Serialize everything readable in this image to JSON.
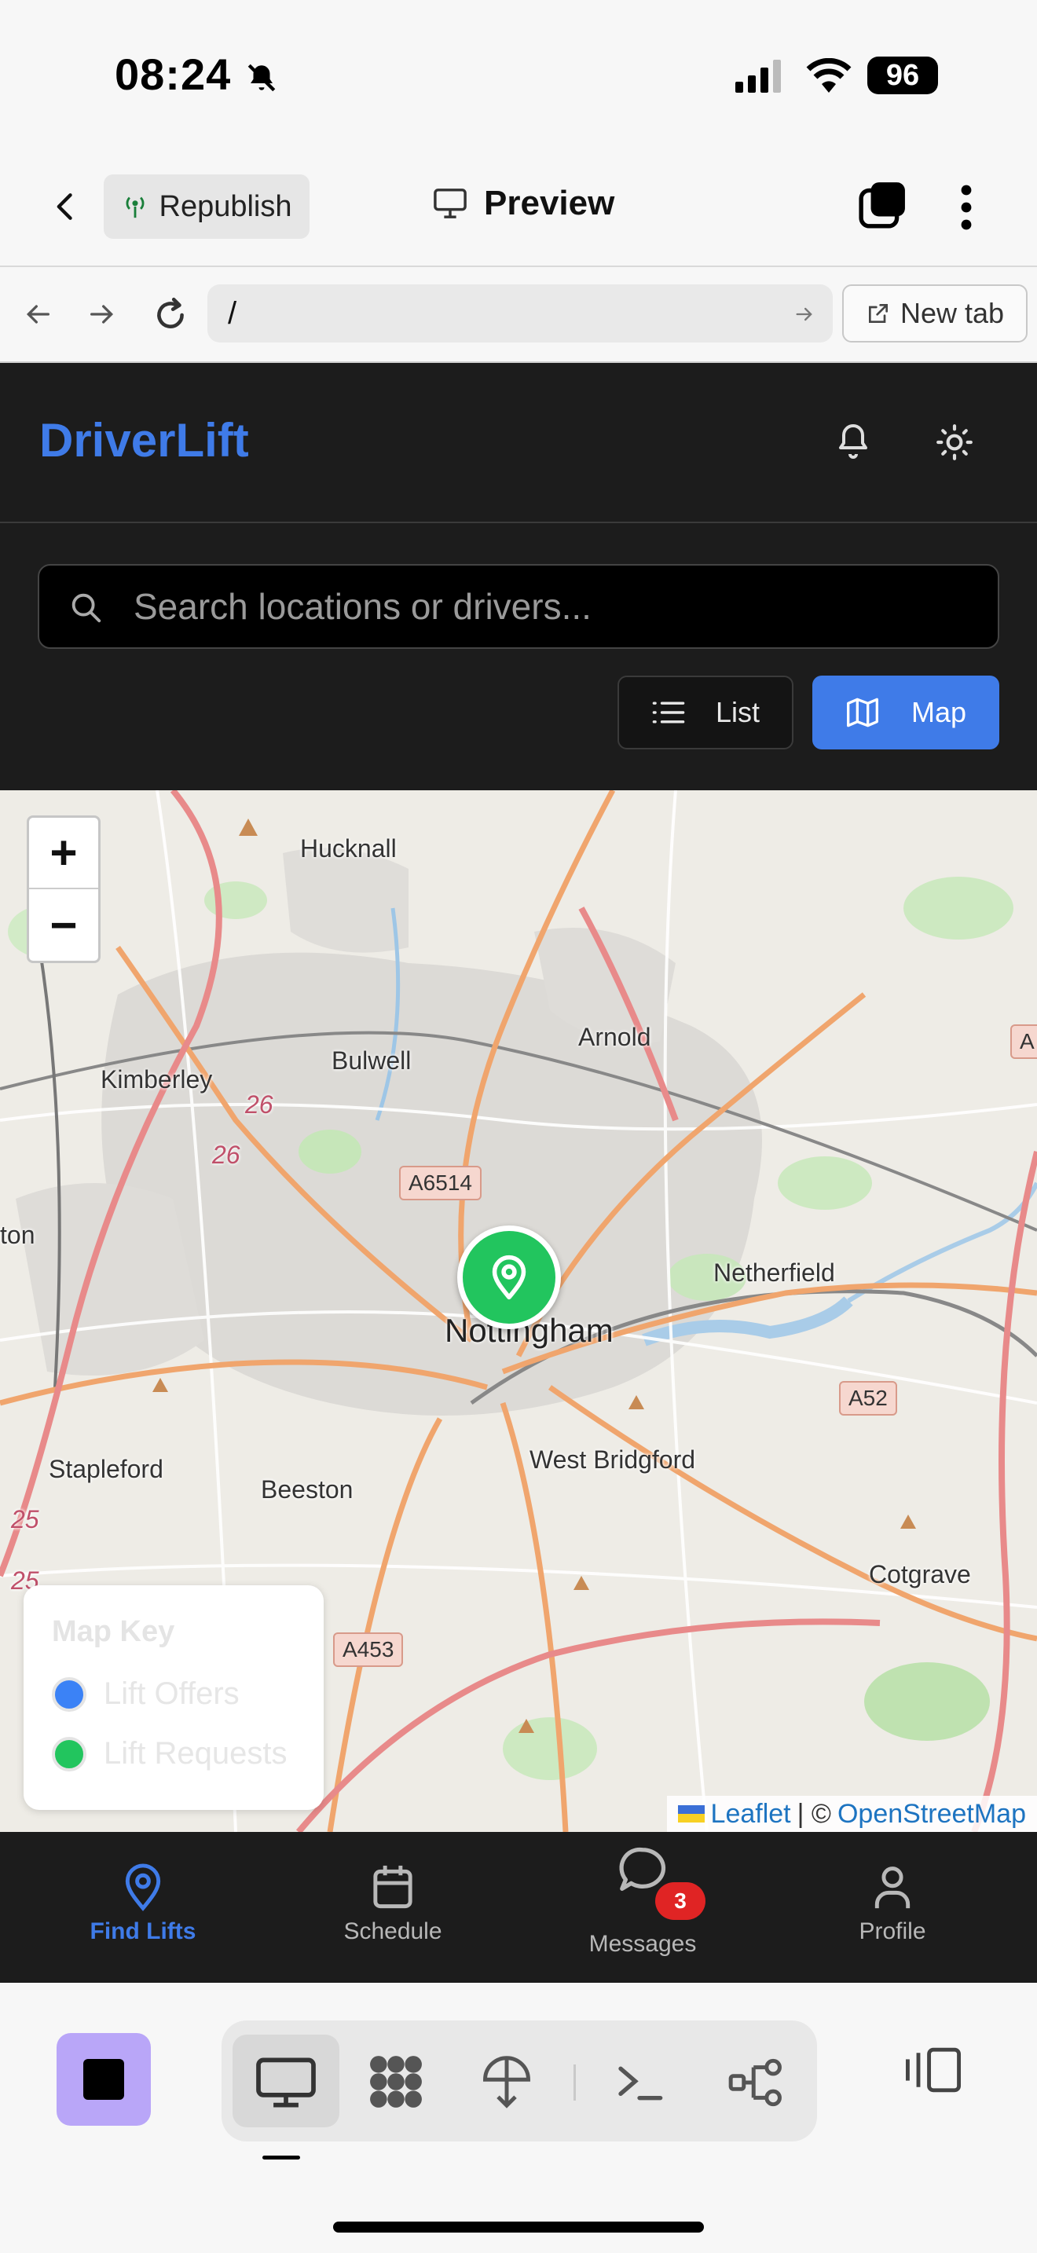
{
  "status_bar": {
    "time": "08:24",
    "battery": "96"
  },
  "preview_toolbar": {
    "republish_label": "Republish",
    "title": "Preview"
  },
  "address_bar": {
    "url": "/",
    "new_tab_label": "New tab"
  },
  "app": {
    "brand": "DriverLift",
    "search_placeholder": "Search locations or drivers...",
    "view_toggle": {
      "list_label": "List",
      "map_label": "Map",
      "active": "Map"
    }
  },
  "map": {
    "zoom_in": "+",
    "zoom_out": "−",
    "places": {
      "hucknall": "Hucknall",
      "arnold": "Arnold",
      "bulwell": "Bulwell",
      "kimberley": "Kimberley",
      "nottingham": "Nottingham",
      "netherfield": "Netherfield",
      "stapleford": "Stapleford",
      "beeston": "Beeston",
      "west_bridgford": "West Bridgford",
      "cotgrave": "Cotgrave",
      "ton": "ton"
    },
    "roads": {
      "a6514": "A6514",
      "a52": "A52",
      "a453": "A453",
      "r26a": "26",
      "r26b": "26",
      "r25a": "25",
      "r25b": "25",
      "a_edge": "A"
    },
    "legend": {
      "title": "Map Key",
      "items": [
        {
          "label": "Lift Offers",
          "color": "#3b82f6"
        },
        {
          "label": "Lift Requests",
          "color": "#22c55e"
        }
      ]
    },
    "marker_color": "#22c55e",
    "attribution": {
      "leaflet": "Leaflet",
      "sep": "| ©",
      "osm": "OpenStreetMap"
    }
  },
  "bottom_nav": {
    "items": [
      {
        "label": "Find Lifts",
        "icon": "map-pin-icon",
        "active": true
      },
      {
        "label": "Schedule",
        "icon": "calendar-icon"
      },
      {
        "label": "Messages",
        "icon": "message-icon",
        "badge": "3"
      },
      {
        "label": "Profile",
        "icon": "user-icon"
      }
    ]
  },
  "colors": {
    "accent": "#3f7be8",
    "header_bg": "#1c1c1c",
    "badge": "#e02424"
  }
}
